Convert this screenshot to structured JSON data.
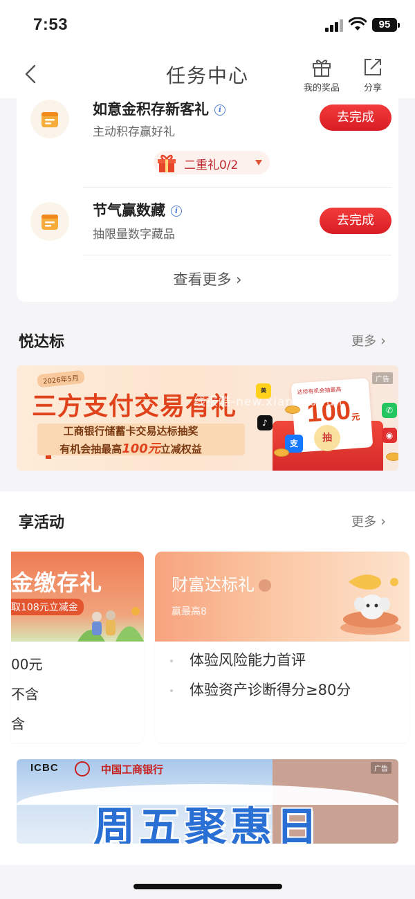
{
  "status_bar": {
    "time": "7:53",
    "battery": "95"
  },
  "nav": {
    "title": "任务中心",
    "prizes_label": "我的奖品",
    "share_label": "分享"
  },
  "tasks": [
    {
      "title": "如意金积存新客礼",
      "subtitle": "主动积存赢好礼",
      "button": "去完成",
      "gift_progress": "二重礼0/2"
    },
    {
      "title": "节气赢数藏",
      "subtitle": "抽限量数字藏品",
      "button": "去完成"
    }
  ],
  "see_more": "查看更多",
  "yuedabiao": {
    "title": "悦达标",
    "more": "更多",
    "banner": {
      "date_tag": "2026年5月",
      "headline": "三方支付交易有礼",
      "line1": "工商银行储蓄卡交易达标抽奖",
      "line2_prefix": "有机会抽最高",
      "line2_amount": "100元",
      "line2_suffix": "立减权益",
      "card_top": "达标有机会抽最高",
      "amount": "100",
      "amount_unit": "元",
      "draw": "抽",
      "ad": "广告",
      "watermark": "线报酷-new.xianbao.fun"
    }
  },
  "enjoy": {
    "title": "享活动",
    "more": "更多",
    "left_card": {
      "title": "金缴存礼",
      "subtitle": "取108元立减金",
      "lines": [
        "00元",
        "不含",
        "含"
      ]
    },
    "right_card": {
      "title": "财富达标礼",
      "subtitle": "赢最高8",
      "lines": [
        "体验风险能力首评",
        "体验资产诊断得分≥80分"
      ]
    }
  },
  "icbc_banner": {
    "logo": "ICBC",
    "bank_name": "中国工商银行",
    "ad": "广告",
    "headline": "周五聚惠日"
  }
}
